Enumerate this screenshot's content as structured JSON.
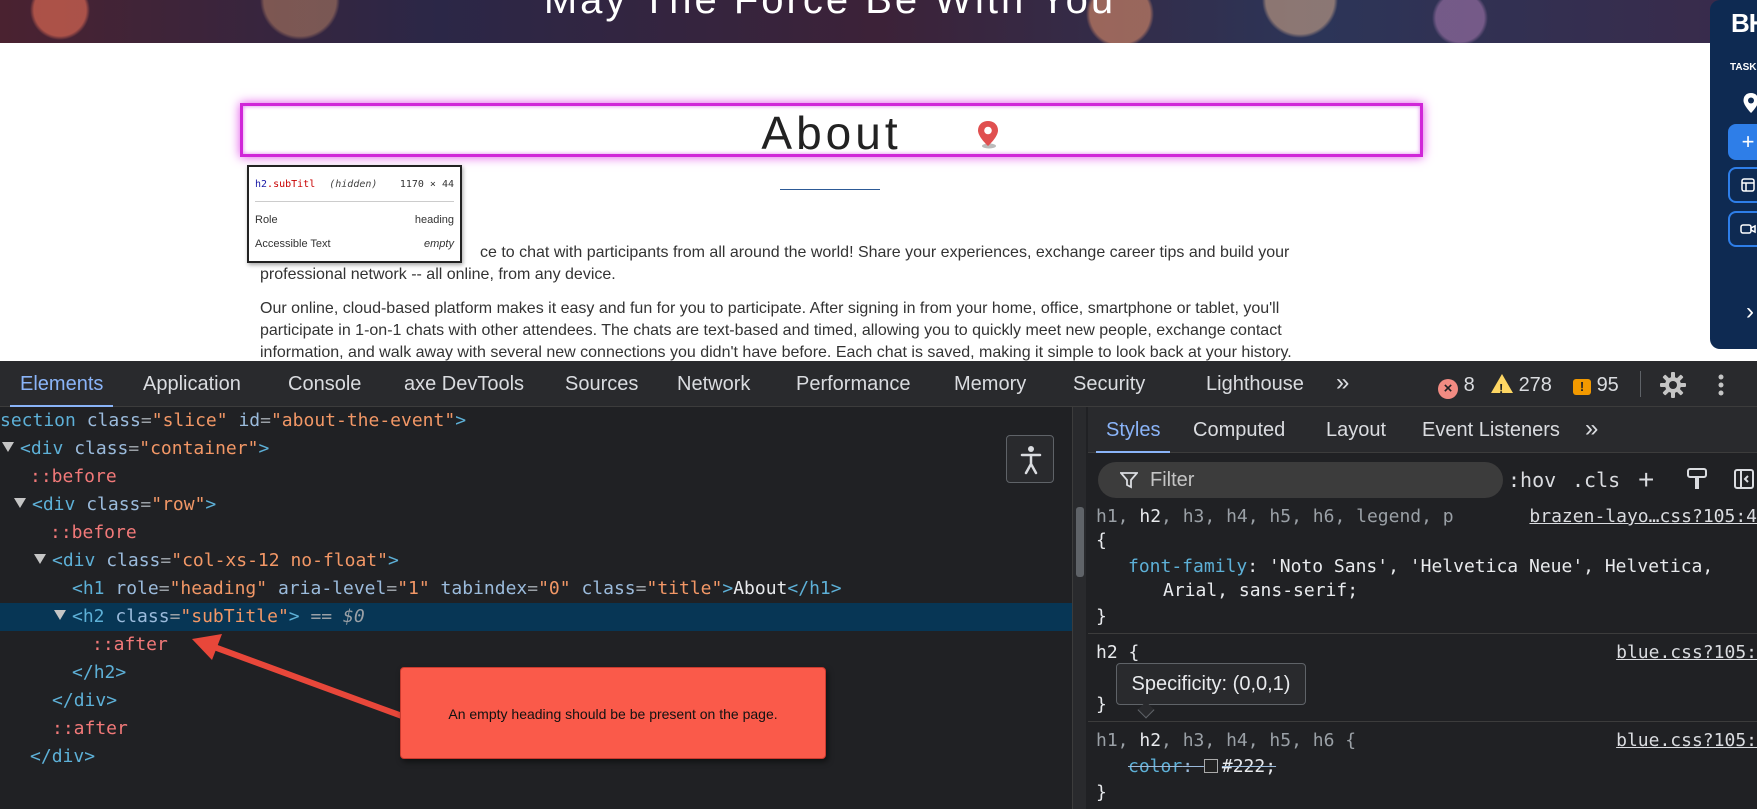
{
  "page": {
    "hero_title": "May The Force Be With You",
    "about_title": "About",
    "para1_line1": "ce to chat with participants from all around the world! Share your experiences, exchange career tips and build your",
    "para1_line2": "professional network -- all online, from any device.",
    "para2_line1": "Our online, cloud-based platform makes it easy and fun for you to participate. After signing in from your home, office, smartphone or tablet, you'll",
    "para2_line2": "participate in 1-on-1 chats with other attendees. The chats are text-based and timed, allowing you to quickly meet new people, exchange contact",
    "para2_line3": "information, and walk away with several new connections you didn't have before. Each chat is saved, making it simple to look back at your history."
  },
  "tooltip": {
    "tag": "h2",
    "class": ".subTitl",
    "hidden": "(hidden)",
    "size": "1170 × 44",
    "role_label": "Role",
    "role_value": "heading",
    "acc_label": "Accessible Text",
    "acc_value": "empty"
  },
  "side_widget": {
    "logo": "BH",
    "task": "TASK",
    "plus": "+"
  },
  "devtools": {
    "tabs": [
      "Elements",
      "Application",
      "Console",
      "axe DevTools",
      "Sources",
      "Network",
      "Performance",
      "Memory",
      "Security",
      "Lighthouse"
    ],
    "more": "»",
    "errors": "8",
    "warnings": "278",
    "issues": "95"
  },
  "dom": {
    "l1_tag": "section",
    "l1_attr": "class",
    "l1_val": "\"slice\"",
    "l1_attr2": "id",
    "l1_val2": "\"about-the-event\"",
    "l2_tag": "div",
    "l2_attr": "class",
    "l2_val": "\"container\"",
    "before1": "::before",
    "l4_tag": "div",
    "l4_attr": "class",
    "l4_val": "\"row\"",
    "before2": "::before",
    "l6_tag": "div",
    "l6_attr": "class",
    "l6_val": "\"col-xs-12 no-float\"",
    "h1_open": "h1",
    "h1_a1": "role",
    "h1_v1": "\"heading\"",
    "h1_a2": "aria-level",
    "h1_v2": "\"1\"",
    "h1_a3": "tabindex",
    "h1_v3": "\"0\"",
    "h1_a4": "class",
    "h1_v4": "\"title\"",
    "h1_text": "About",
    "h1_close": "h1",
    "h2_tag": "h2",
    "h2_attr": "class",
    "h2_val": "\"subTitle\"",
    "h2_eq": "==",
    "h2_dollar": "$0",
    "after1": "::after",
    "h2_close": "h2",
    "div_close": "div",
    "after2": "::after",
    "div_close2": "div"
  },
  "annotation": {
    "text": "An empty heading should be be present on the page."
  },
  "styles": {
    "tabs": [
      "Styles",
      "Computed",
      "Layout",
      "Event Listeners"
    ],
    "more": "»",
    "filter_placeholder": "Filter",
    "hov": ":hov",
    "cls": ".cls",
    "plus": "+",
    "rule1_sel_pre": "h1, ",
    "rule1_sel_on": "h2",
    "rule1_sel_post": ", h3, h4, h5, h6, legend, p",
    "rule1_src": "brazen-layo…css?105:4",
    "rule1_prop": "font-family",
    "rule1_val1": " 'Noto Sans', 'Helvetica Neue', Helvetica,",
    "rule1_val2": "Arial, sans-serif;",
    "rule2_sel": "h2 {",
    "rule2_src": "blue.css?105:",
    "rule3_sel_pre": "h1, ",
    "rule3_sel_on": "h2",
    "rule3_sel_post": ", h3, h4, h5, h6 {",
    "rule3_src": "blue.css?105:",
    "rule3_prop": "color",
    "rule3_val": "#222;",
    "open_brace": "{",
    "close_brace": "}",
    "specificity": "Specificity: (0,0,1)"
  },
  "colors": {
    "highlight": "#d026d8",
    "callout": "#fa5a4a",
    "devtools_bg": "#202124",
    "accent": "#8ab4f8"
  }
}
